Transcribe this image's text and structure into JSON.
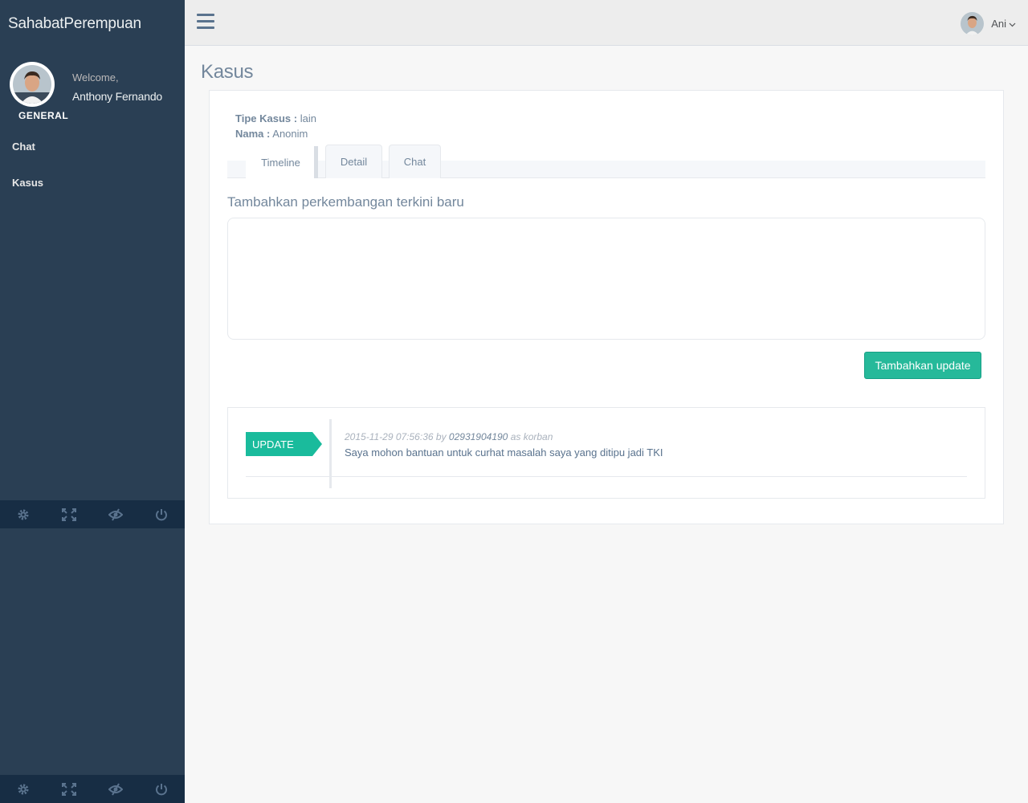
{
  "sidebar": {
    "brand": "SahabatPerempuan",
    "welcome": "Welcome,",
    "username": "Anthony Fernando",
    "section_title": "GENERAL",
    "items": [
      {
        "label": "Chat"
      },
      {
        "label": "Kasus"
      }
    ],
    "footer_icons": [
      "settings-icon",
      "fullscreen-icon",
      "eye-slash-icon",
      "power-icon"
    ]
  },
  "topnav": {
    "menu_icon": "hamburger-icon",
    "user_name": "Ani",
    "user_menu_icon": "chevron-down-icon"
  },
  "page": {
    "title": "Kasus"
  },
  "case": {
    "tipe_label": "Tipe Kasus",
    "tipe_value": "lain",
    "nama_label": "Nama",
    "nama_value": "Anonim"
  },
  "tabs": [
    {
      "label": "Timeline",
      "active": true
    },
    {
      "label": "Detail",
      "active": false
    },
    {
      "label": "Chat",
      "active": false
    }
  ],
  "form": {
    "label": "Tambahkan perkembangan terkini baru",
    "textarea_value": "",
    "submit_label": "Tambahkan update"
  },
  "timeline": [
    {
      "tag": "UPDATE",
      "timestamp": "2015-11-29 07:56:36",
      "by_text": "by",
      "author": "02931904190",
      "role_text": "as korban",
      "text": "Saya mohon bantuan untuk curhat masalah saya yang ditipu jadi TKI"
    }
  ],
  "colors": {
    "sidebar_bg": "#2a3f54",
    "sidebar_footer": "#172d44",
    "accent_green": "#26b99a",
    "text_muted": "#73879c"
  }
}
